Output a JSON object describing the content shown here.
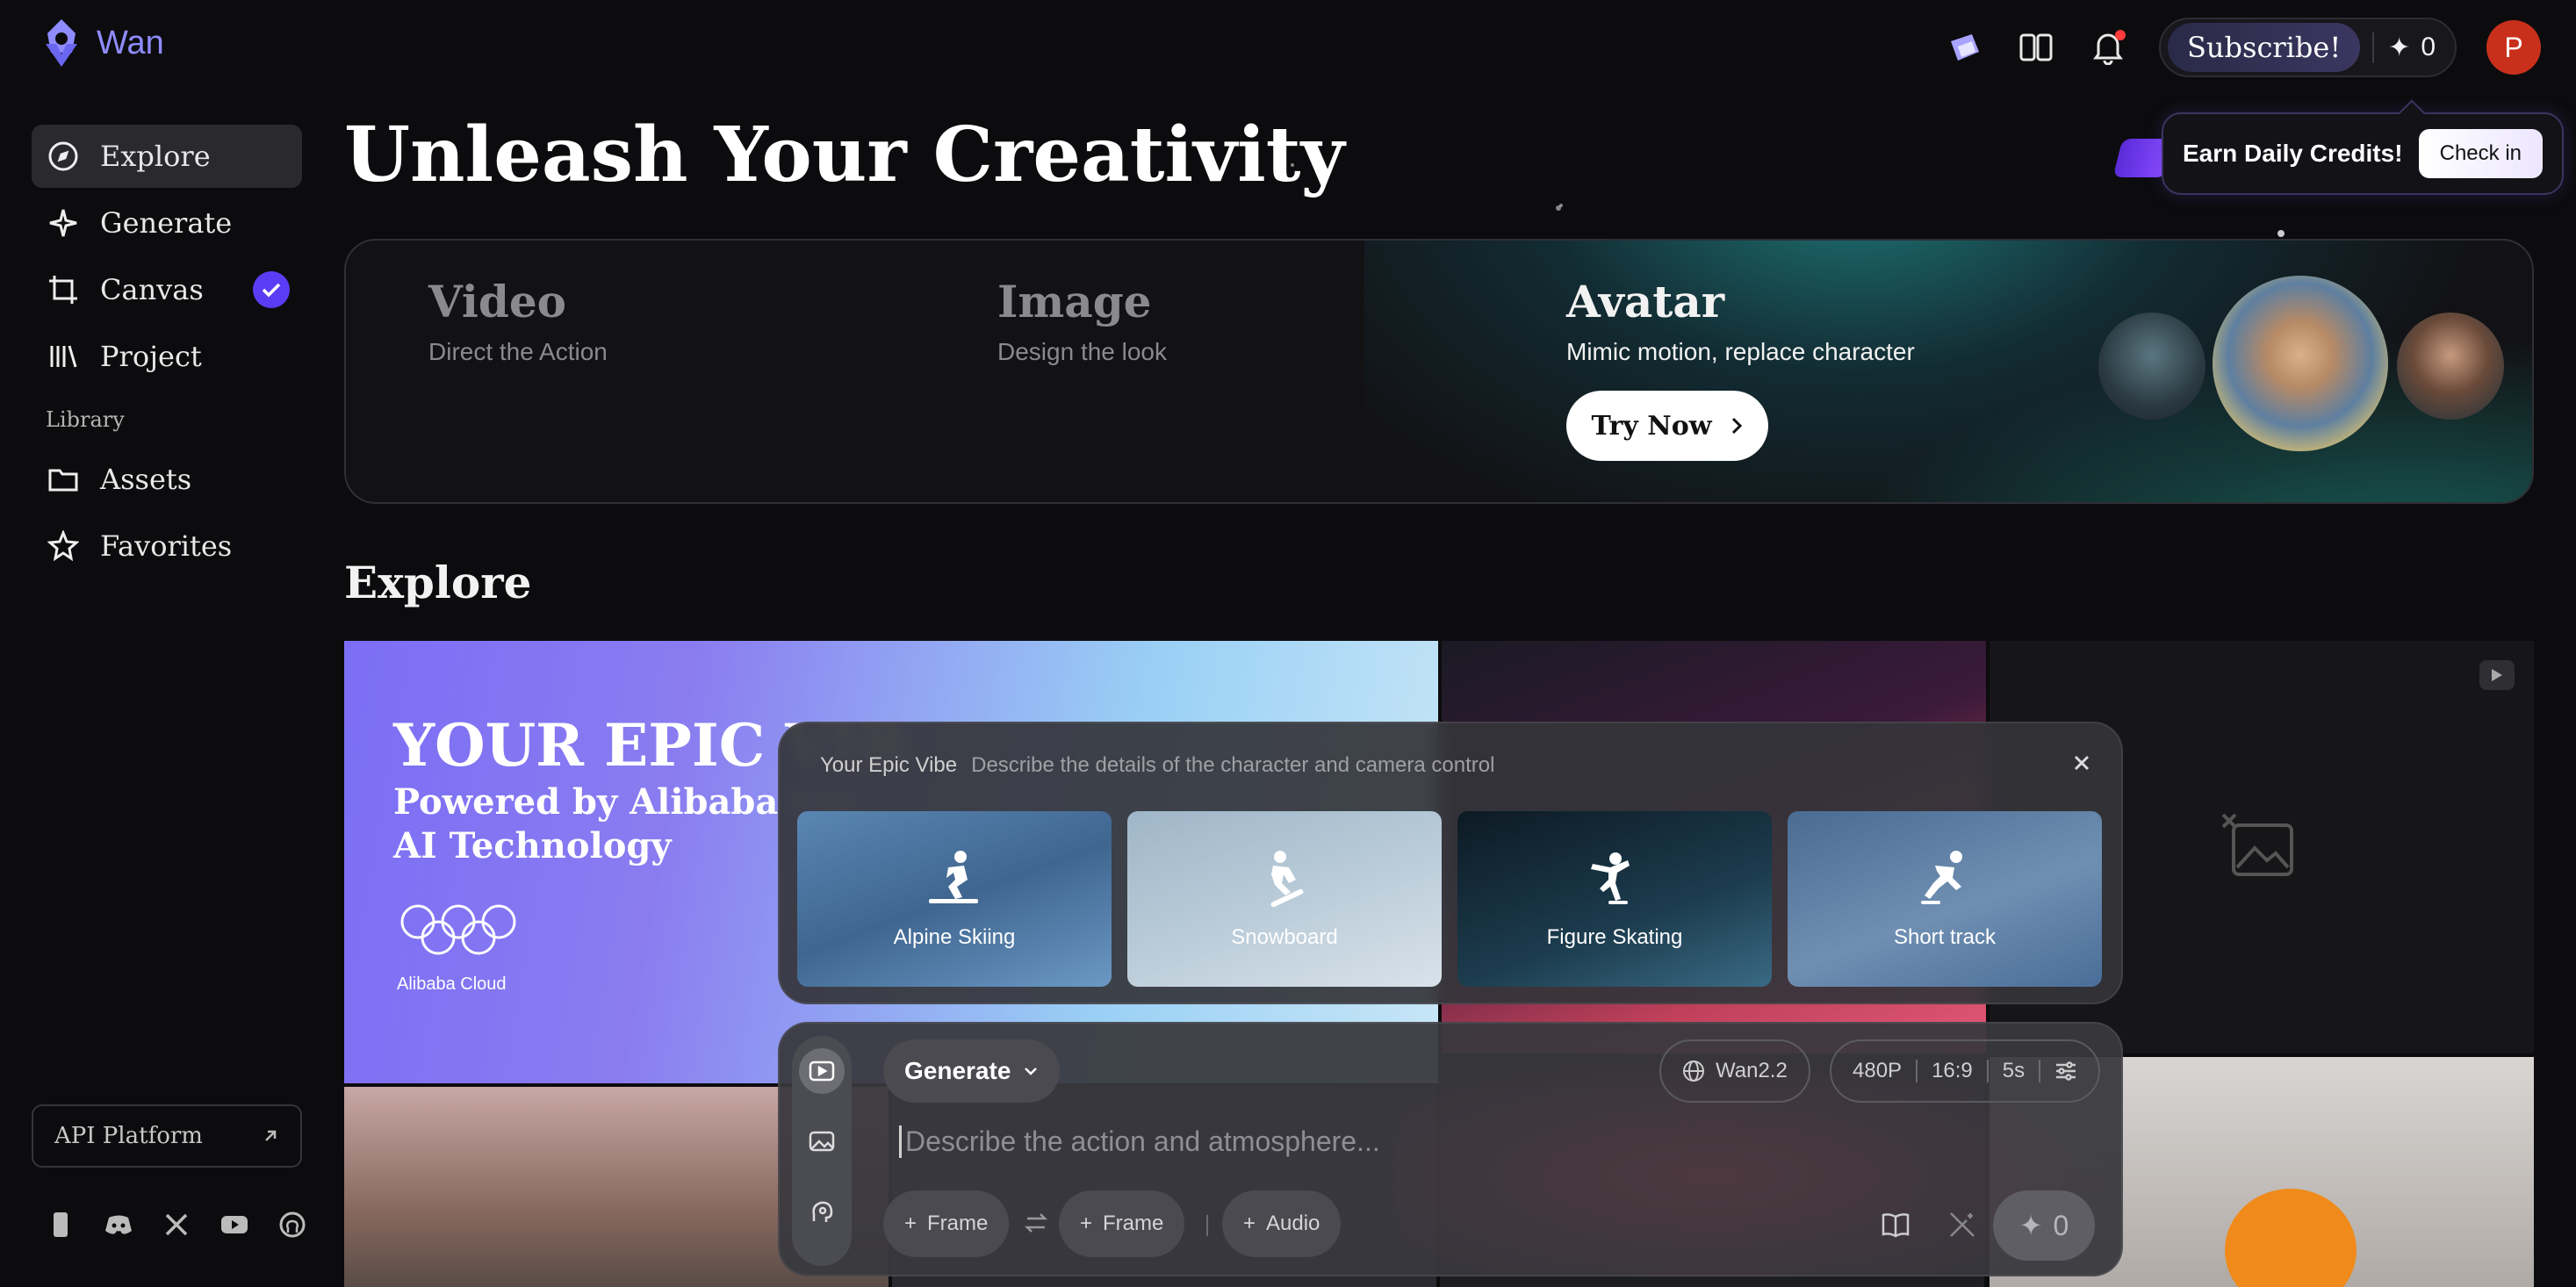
{
  "app": {
    "name": "Wan"
  },
  "topbar": {
    "subscribe_label": "Subscribe!",
    "credits": "0",
    "avatar_initial": "P"
  },
  "credits_popup": {
    "text": "Earn Daily Credits!",
    "button": "Check in"
  },
  "sidebar": {
    "items": [
      {
        "label": "Explore",
        "icon": "compass-icon",
        "active": true
      },
      {
        "label": "Generate",
        "icon": "sparkle-icon"
      },
      {
        "label": "Canvas",
        "icon": "crop-icon",
        "badge": "check-icon"
      },
      {
        "label": "Project",
        "icon": "library-icon"
      }
    ],
    "library_label": "Library",
    "library_items": [
      {
        "label": "Assets",
        "icon": "folder-icon"
      },
      {
        "label": "Favorites",
        "icon": "star-icon"
      }
    ],
    "api_label": "API Platform",
    "socials": [
      "phone-icon",
      "discord-icon",
      "x-icon",
      "youtube-icon",
      "github-icon"
    ]
  },
  "page": {
    "title": "Unleash Your Creativity"
  },
  "hero": {
    "video": {
      "title": "Video",
      "subtitle": "Direct the Action"
    },
    "image": {
      "title": "Image",
      "subtitle": "Design the look"
    },
    "avatar": {
      "title": "Avatar",
      "subtitle": "Mimic motion, replace character",
      "cta": "Try Now"
    }
  },
  "explore": {
    "title": "Explore",
    "feature_tile": {
      "headline": "YOUR EPIC VIB",
      "line1": "Powered by Alibaba Clo",
      "line2": "AI Technology",
      "partner": "Alibaba Cloud"
    }
  },
  "vibe_panel": {
    "title": "Your Epic Vibe",
    "description": "Describe the details of the character and camera control",
    "options": [
      {
        "label": "Alpine Skiing",
        "icon": "skiing-icon"
      },
      {
        "label": "Snowboard",
        "icon": "snowboard-icon"
      },
      {
        "label": "Figure Skating",
        "icon": "figure-skating-icon"
      },
      {
        "label": "Short track",
        "icon": "speed-skating-icon"
      }
    ]
  },
  "composer": {
    "mode_label": "Generate",
    "model": "Wan2.2",
    "resolution": "480P",
    "ratio": "16:9",
    "duration": "5s",
    "placeholder": "Describe the action and atmosphere...",
    "chips": [
      "Frame",
      "Frame",
      "Audio"
    ],
    "send_credits": "0"
  },
  "colors": {
    "accent": "#5b3cf5",
    "logo": "#8f8cff",
    "avatar_bg": "#c9301c",
    "background": "#0c0c0e"
  }
}
